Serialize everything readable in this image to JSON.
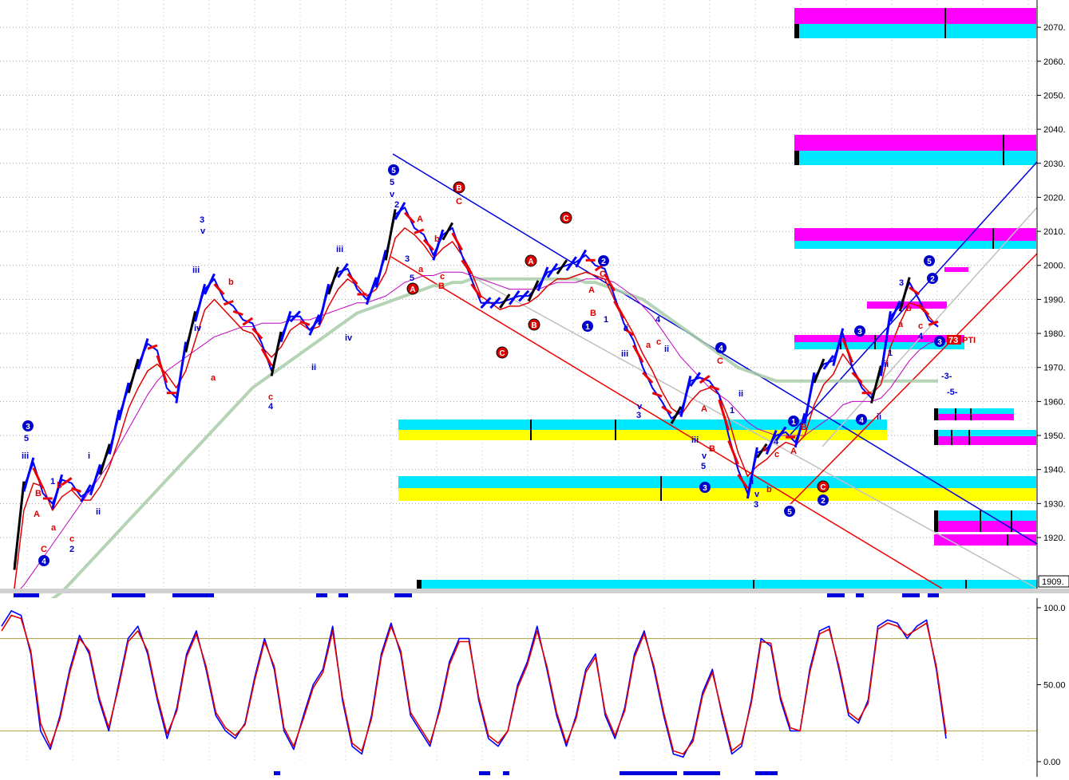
{
  "chart_data": [
    {
      "type": "line",
      "panel": "price",
      "ylim": [
        1905,
        2078
      ],
      "y_ticks": [
        "2070.",
        "2060.",
        "2050.",
        "2040.",
        "2030.",
        "2020.",
        "2010.",
        "2000.",
        "1990.",
        "1980.",
        "1970.",
        "1960.",
        "1950.",
        "1940.",
        "1930.",
        "1920."
      ],
      "y_tick_values": [
        2070,
        2060,
        2050,
        2040,
        2030,
        2020,
        2010,
        2000,
        1990,
        1980,
        1970,
        1960,
        1950,
        1940,
        1930,
        1920
      ],
      "last_price_label": "1909.",
      "grid": true,
      "series": [
        {
          "color": "#0000ff",
          "values": [
            1912,
            1935,
            1942,
            1933,
            1930,
            1937,
            1936,
            1932,
            1934,
            1940,
            1946,
            1956,
            1964,
            1971,
            1977,
            1975,
            1964,
            1961,
            1976,
            1985,
            1993,
            1996,
            1990,
            1988,
            1984,
            1983,
            1977,
            1969,
            1979,
            1985,
            1985,
            1981,
            1984,
            1993,
            1998,
            1999,
            1993,
            1990,
            1995,
            2003,
            2015,
            2017,
            2011,
            2009,
            2003,
            2009,
            2011,
            2003,
            1996,
            1989,
            1989,
            1989,
            1990,
            1991,
            1991,
            1994,
            1998,
            1999,
            2000,
            2001,
            2003,
            2000,
            1999,
            1991,
            1983,
            1978,
            1970,
            1964,
            1960,
            1955,
            1957,
            1966,
            1967,
            1966,
            1962,
            1950,
            1940,
            1933,
            1945,
            1946,
            1950,
            1951,
            1948,
            1955,
            1967,
            1971,
            1972,
            1980,
            1970,
            1964,
            1961,
            1969,
            1985,
            1988,
            1995,
            1990,
            1984,
            1982
          ]
        },
        {
          "color": "#e00000",
          "values": [
            1905,
            1928,
            1936,
            1935,
            1928,
            1932,
            1934,
            1931,
            1931,
            1935,
            1941,
            1949,
            1958,
            1964,
            1969,
            1971,
            1968,
            1964,
            1969,
            1978,
            1987,
            1990,
            1987,
            1984,
            1981,
            1980,
            1976,
            1973,
            1976,
            1981,
            1983,
            1981,
            1982,
            1988,
            1993,
            1996,
            1994,
            1991,
            1993,
            1998,
            2008,
            2011,
            2009,
            2006,
            2002,
            2005,
            2007,
            2003,
            1998,
            1991,
            1989,
            1987,
            1988,
            1988,
            1989,
            1991,
            1994,
            1996,
            1996,
            1997,
            1998,
            1997,
            1996,
            1990,
            1985,
            1980,
            1974,
            1969,
            1963,
            1958,
            1956,
            1960,
            1963,
            1964,
            1962,
            1955,
            1945,
            1938,
            1941,
            1943,
            1946,
            1948,
            1947,
            1950,
            1959,
            1965,
            1968,
            1974,
            1970,
            1965,
            1962,
            1965,
            1976,
            1983,
            1989,
            1988,
            1985,
            1982
          ]
        },
        {
          "color": "#c000c0",
          "values": [
            1903,
            1906,
            1910,
            1914,
            1918,
            1922,
            1926,
            1930,
            1934,
            1938,
            1942,
            1947,
            1952,
            1957,
            1962,
            1966,
            1969,
            1971,
            1973,
            1975,
            1977,
            1979,
            1980,
            1981,
            1982,
            1982,
            1983,
            1983,
            1983,
            1984,
            1984,
            1984,
            1985,
            1986,
            1987,
            1988,
            1989,
            1989,
            1990,
            1991,
            1993,
            1995,
            1996,
            1997,
            1997,
            1998,
            1998,
            1998,
            1997,
            1996,
            1995,
            1994,
            1993,
            1993,
            1993,
            1993,
            1994,
            1995,
            1995,
            1995,
            1996,
            1996,
            1996,
            1995,
            1993,
            1991,
            1988,
            1985,
            1981,
            1977,
            1973,
            1970,
            1967,
            1964,
            1962,
            1960,
            1957,
            1954,
            1952,
            1951,
            1950,
            1950,
            1950,
            1950,
            1952,
            1954,
            1956,
            1959,
            1960,
            1960,
            1960,
            1961,
            1964,
            1968,
            1972,
            1975,
            1977,
            1978
          ]
        },
        {
          "color": "#a8cca8",
          "values": [
            1895,
            1896,
            1898,
            1900,
            1902,
            1904,
            1907,
            1910,
            1913,
            1916,
            1919,
            1922,
            1925,
            1928,
            1931,
            1934,
            1937,
            1940,
            1943,
            1946,
            1949,
            1952,
            1955,
            1958,
            1961,
            1964,
            1966,
            1968,
            1970,
            1972,
            1974,
            1976,
            1978,
            1980,
            1982,
            1984,
            1986,
            1987,
            1988,
            1989,
            1990,
            1991,
            1992,
            1993,
            1994,
            1994,
            1995,
            1995,
            1996,
            1996,
            1996,
            1996,
            1996,
            1996,
            1996,
            1996,
            1996,
            1996,
            1996,
            1996,
            1995,
            1995,
            1994,
            1993,
            1992,
            1991,
            1990,
            1988,
            1986,
            1984,
            1982,
            1980,
            1978,
            1976,
            1974,
            1972,
            1970,
            1969,
            1968,
            1967,
            1966,
            1966,
            1966,
            1966,
            1966,
            1966,
            1966,
            1966,
            1966,
            1966,
            1966,
            1966,
            1966,
            1966,
            1966,
            1966,
            1966,
            1966
          ]
        }
      ]
    },
    {
      "type": "line",
      "panel": "oscillator",
      "ylim": [
        0,
        100
      ],
      "y_ticks": [
        "100.0",
        "50.00",
        "0.00"
      ],
      "y_tick_values": [
        100,
        50,
        0
      ],
      "reference_lines": [
        80,
        20
      ],
      "series": [
        {
          "color": "#0000ff",
          "values": [
            88,
            98,
            95,
            70,
            20,
            8,
            30,
            60,
            82,
            70,
            40,
            20,
            50,
            80,
            88,
            70,
            40,
            15,
            35,
            70,
            85,
            60,
            30,
            20,
            15,
            25,
            55,
            80,
            60,
            20,
            8,
            30,
            50,
            60,
            88,
            40,
            10,
            5,
            30,
            70,
            90,
            70,
            30,
            20,
            10,
            35,
            65,
            80,
            80,
            40,
            15,
            10,
            20,
            50,
            65,
            88,
            60,
            30,
            10,
            30,
            60,
            70,
            30,
            15,
            35,
            70,
            85,
            60,
            30,
            5,
            3,
            15,
            45,
            60,
            30,
            5,
            10,
            40,
            80,
            75,
            40,
            20,
            20,
            60,
            85,
            88,
            60,
            30,
            25,
            40,
            88,
            92,
            90,
            80,
            88,
            92,
            60,
            15
          ]
        },
        {
          "color": "#e00000",
          "values": [
            85,
            95,
            93,
            72,
            25,
            10,
            28,
            58,
            80,
            72,
            42,
            22,
            48,
            78,
            85,
            72,
            42,
            18,
            33,
            68,
            83,
            62,
            32,
            22,
            17,
            24,
            53,
            78,
            62,
            22,
            10,
            28,
            48,
            58,
            85,
            42,
            12,
            7,
            28,
            68,
            88,
            72,
            32,
            22,
            12,
            33,
            63,
            78,
            78,
            42,
            17,
            12,
            20,
            48,
            63,
            85,
            62,
            32,
            12,
            28,
            58,
            68,
            32,
            17,
            33,
            68,
            83,
            62,
            32,
            7,
            5,
            13,
            43,
            58,
            32,
            7,
            12,
            38,
            78,
            77,
            42,
            22,
            20,
            58,
            83,
            86,
            62,
            32,
            27,
            38,
            86,
            90,
            88,
            82,
            86,
            90,
            62,
            18
          ]
        }
      ]
    }
  ]
}
